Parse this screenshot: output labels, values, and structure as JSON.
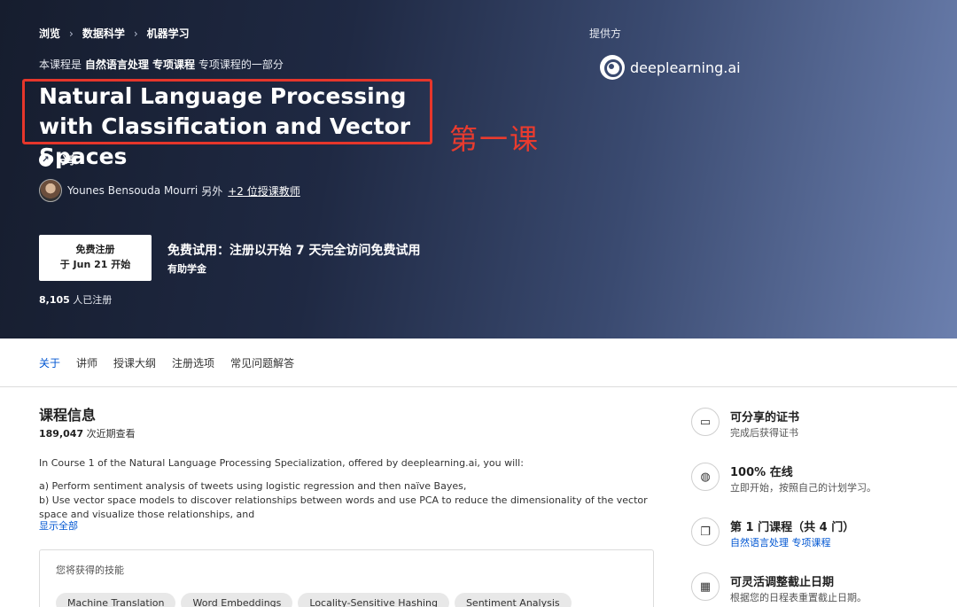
{
  "breadcrumb": [
    "浏览",
    "数据科学",
    "机器学习"
  ],
  "hero": {
    "part_of_prefix": "本课程是",
    "part_of_link": "自然语言处理 专项课程",
    "part_of_suffix": "专项课程的一部分",
    "title": "Natural Language Processing with Classification and Vector Spaces",
    "annotation": "第一课",
    "share_label": "分享",
    "instructor_name": "Younes Bensouda Mourri",
    "instructor_other": "另外",
    "instructor_more": "+2 位授课教师",
    "enroll_line1": "免费注册",
    "enroll_line2": "于 Jun 21 开始",
    "trial_title": "免费试用：注册以开始 7 天完全访问免费试用",
    "trial_sub": "有助学金",
    "enrolled_count": "8,105",
    "enrolled_suffix": "人已注册",
    "provider_label": "提供方",
    "provider_name": "deeplearning.ai"
  },
  "tabs": [
    "关于",
    "讲师",
    "授课大纲",
    "注册选项",
    "常见问题解答"
  ],
  "main": {
    "heading": "课程信息",
    "views_count": "189,047",
    "views_suffix": "次近期查看",
    "desc_intro": "In Course 1 of the Natural Language Processing Specialization, offered by deeplearning.ai, you will:",
    "desc_a": "a) Perform sentiment analysis of tweets using logistic regression and then naïve Bayes,",
    "desc_b": "b) Use vector space models to discover relationships between words and use PCA to reduce the dimensionality of the vector space and visualize those relationships, and",
    "show_all": "显示全部",
    "skills_title": "您将获得的技能",
    "skills": [
      "Machine Translation",
      "Word Embeddings",
      "Locality-Sensitive Hashing",
      "Sentiment Analysis"
    ]
  },
  "sidebar": [
    {
      "icon": "certificate-icon",
      "title": "可分享的证书",
      "sub": "完成后获得证书"
    },
    {
      "icon": "globe-icon",
      "title": "100% 在线",
      "sub": "立即开始，按照自己的计划学习。"
    },
    {
      "icon": "stack-icon",
      "title": "第 1 门课程（共 4 门）",
      "sub": "自然语言处理 专项课程"
    },
    {
      "icon": "calendar-icon",
      "title": "可灵活调整截止日期",
      "sub": "根据您的日程表重置截止日期。"
    }
  ],
  "colors": {
    "link": "#0056d2",
    "annotation": "#e6362b"
  }
}
